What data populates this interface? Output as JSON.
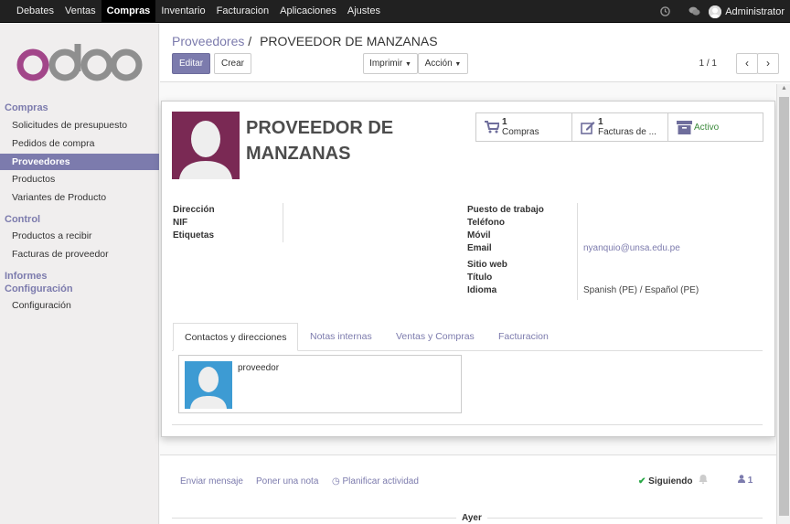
{
  "topbar": {
    "menu": [
      "Debates",
      "Ventas",
      "Compras",
      "Inventario",
      "Facturacion",
      "Aplicaciones",
      "Ajustes"
    ],
    "active": "Compras",
    "user": "Administrator"
  },
  "sidebar": {
    "sections": [
      {
        "title": "Compras",
        "items": [
          "Solicitudes de presupuesto",
          "Pedidos de compra",
          "Proveedores",
          "Productos",
          "Variantes de Producto"
        ]
      },
      {
        "title": "Control",
        "items": [
          "Productos a recibir",
          "Facturas de proveedor"
        ]
      },
      {
        "title": "Informes",
        "items": []
      },
      {
        "title": "Configuración",
        "items": [
          "Configuración"
        ]
      }
    ],
    "active_item": "Proveedores",
    "logo_text": "odoo"
  },
  "control_panel": {
    "breadcrumb_parent": "Proveedores",
    "breadcrumb_sep": "/",
    "breadcrumb_current": "PROVEEDOR DE MANZANAS",
    "edit_label": "Editar",
    "create_label": "Crear",
    "print_label": "Imprimir",
    "action_label": "Acción",
    "pager": "1 / 1"
  },
  "form": {
    "name_line1": "PROVEEDOR DE",
    "name_line2": "MANZANAS",
    "smart_buttons": [
      {
        "count": "1",
        "label": "Compras",
        "icon": "cart-icon"
      },
      {
        "count": "1",
        "label": "Facturas de ...",
        "icon": "edit-icon"
      },
      {
        "count": "",
        "label": "Activo",
        "icon": "archive-icon"
      }
    ],
    "left_fields": [
      {
        "label": "Dirección",
        "value": ""
      },
      {
        "label": "NIF",
        "value": ""
      },
      {
        "label": "Etiquetas",
        "value": ""
      }
    ],
    "right_fields": [
      {
        "label": "Puesto de trabajo",
        "value": ""
      },
      {
        "label": "Teléfono",
        "value": ""
      },
      {
        "label": "Móvil",
        "value": ""
      },
      {
        "label": "Email",
        "value": "nyanquio@unsa.edu.pe"
      },
      {
        "label": "Sitio web",
        "value": ""
      },
      {
        "label": "Título",
        "value": ""
      },
      {
        "label": "Idioma",
        "value": "Spanish (PE) / Español (PE)"
      }
    ],
    "tabs": [
      "Contactos y direcciones",
      "Notas internas",
      "Ventas y Compras",
      "Facturacion"
    ],
    "active_tab": "Contactos y direcciones",
    "contact_name": "proveedor"
  },
  "chatter": {
    "send_message": "Enviar mensaje",
    "log_note": "Poner una nota",
    "schedule": "Planificar actividad",
    "following": "Siguiendo",
    "followers_count": "1",
    "day_separator": "Ayer"
  },
  "colors": {
    "brand": "#7c7bad",
    "topbar": "#212121",
    "partner_bg": "#7a2954",
    "contact_bg": "#3d9bd3"
  }
}
